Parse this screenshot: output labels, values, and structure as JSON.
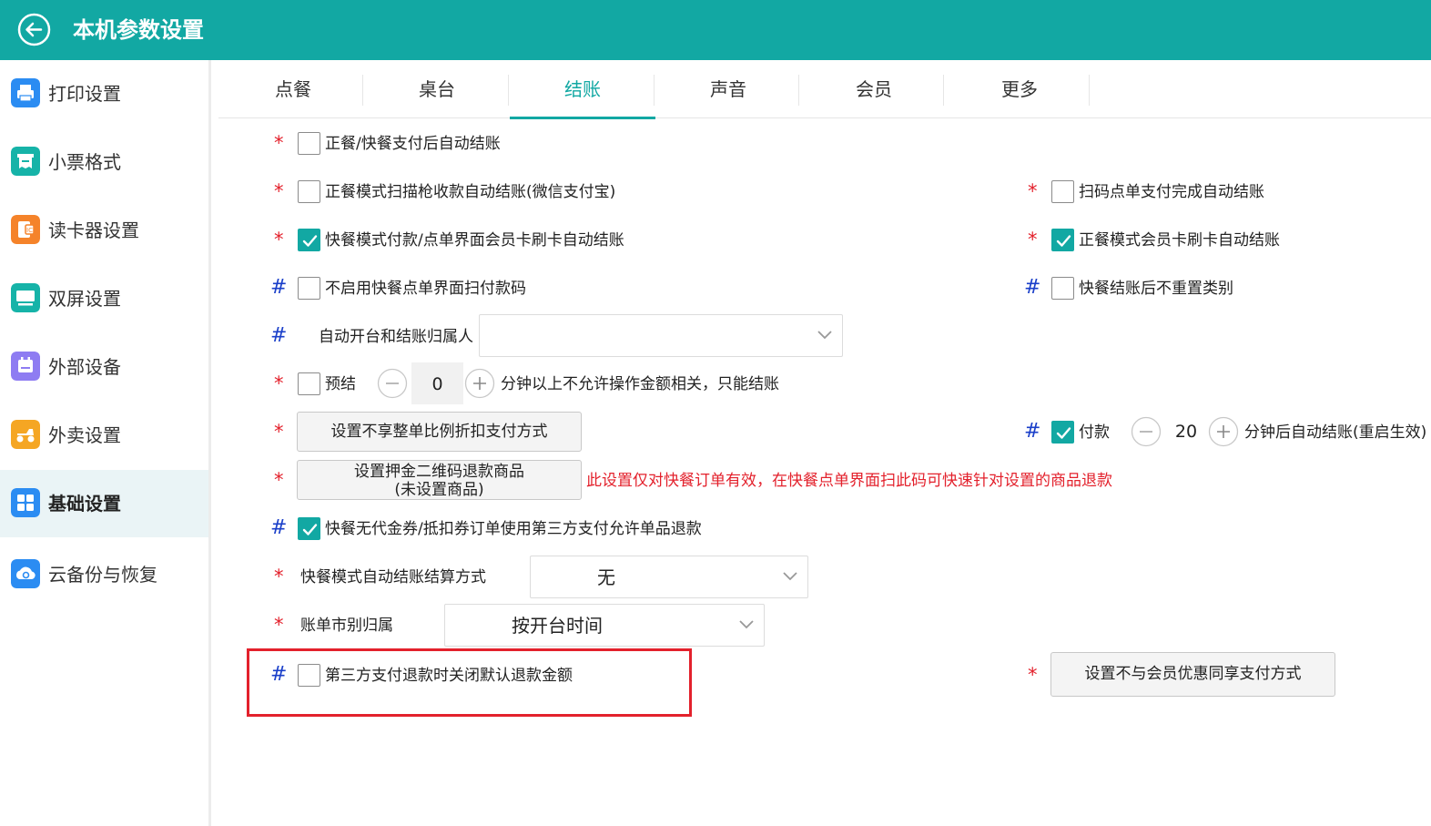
{
  "header": {
    "title": "本机参数设置"
  },
  "sidebar": {
    "items": [
      {
        "label": "打印设置",
        "color": "#2b8cf2"
      },
      {
        "label": "小票格式",
        "color": "#16b3a8"
      },
      {
        "label": "读卡器设置",
        "color": "#f5832a"
      },
      {
        "label": "双屏设置",
        "color": "#16b3a8"
      },
      {
        "label": "外部设备",
        "color": "#8e7cf2"
      },
      {
        "label": "外卖设置",
        "color": "#f5a623"
      },
      {
        "label": "基础设置",
        "color": "#2b8cf2"
      },
      {
        "label": "云备份与恢复",
        "color": "#2b8cf2"
      }
    ],
    "active_index": 6
  },
  "tabs": {
    "items": [
      "点餐",
      "桌台",
      "结账",
      "声音",
      "会员",
      "更多"
    ],
    "active_index": 2
  },
  "settings": {
    "row1": {
      "mark": "*",
      "label": "正餐/快餐支付后自动结账",
      "checked": false
    },
    "row2": {
      "left": {
        "mark": "*",
        "label": "正餐模式扫描枪收款自动结账(微信支付宝)",
        "checked": false
      },
      "right": {
        "mark": "*",
        "label": "扫码点单支付完成自动结账",
        "checked": false
      }
    },
    "row3": {
      "left": {
        "mark": "*",
        "label": "快餐模式付款/点单界面会员卡刷卡自动结账",
        "checked": true
      },
      "right": {
        "mark": "*",
        "label": "正餐模式会员卡刷卡自动结账",
        "checked": true
      }
    },
    "row4": {
      "left": {
        "mark": "#",
        "label": "不启用快餐点单界面扫付款码",
        "checked": false
      },
      "right": {
        "mark": "#",
        "label": "快餐结账后不重置类别",
        "checked": false
      }
    },
    "row5": {
      "mark": "#",
      "label": "自动开台和结账归属人",
      "value": ""
    },
    "row6": {
      "mark": "*",
      "label": "预结",
      "checked": false,
      "stepper_value": "0",
      "suffix": "分钟以上不允许操作金额相关，只能结账"
    },
    "row7": {
      "left": {
        "mark": "*",
        "button": "设置不享整单比例折扣支付方式"
      },
      "right": {
        "mark": "#",
        "label": "付款",
        "checked": true,
        "stepper_value": "20",
        "suffix": "分钟后自动结账(重启生效)"
      }
    },
    "row8": {
      "mark": "*",
      "button_line1": "设置押金二维码退款商品",
      "button_line2": "(未设置商品)",
      "note": "此设置仅对快餐订单有效，在快餐点单界面扫此码可快速针对设置的商品退款"
    },
    "row9": {
      "mark": "#",
      "label": "快餐无代金券/抵扣券订单使用第三方支付允许单品退款",
      "checked": true
    },
    "row10": {
      "mark": "*",
      "label": "快餐模式自动结账结算方式",
      "value": "无"
    },
    "row11": {
      "mark": "*",
      "label": "账单市别归属",
      "value": "按开台时间"
    },
    "row12": {
      "left": {
        "mark": "#",
        "label": "第三方支付退款时关闭默认退款金额",
        "checked": false
      },
      "right": {
        "mark": "*",
        "button": "设置不与会员优惠同享支付方式"
      }
    }
  },
  "colors": {
    "accent": "#12a8a3",
    "required": "#e3212c",
    "hash": "#1a3fc9"
  }
}
